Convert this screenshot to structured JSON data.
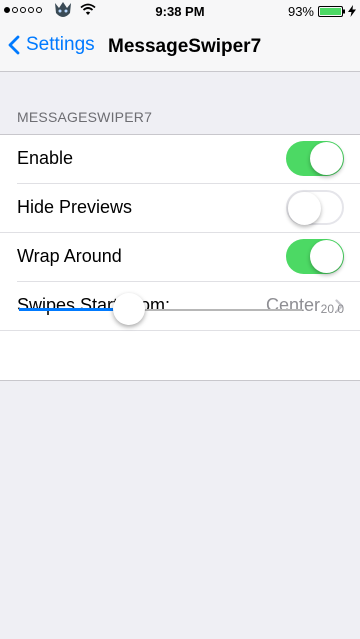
{
  "status_bar": {
    "time": "9:38 PM",
    "battery_percent": "93%",
    "signal_bars_filled": 1,
    "signal_bars_total": 5
  },
  "nav": {
    "back_label": "Settings",
    "title": "MessageSwiper7"
  },
  "section": {
    "header": "MESSAGESWIPER7"
  },
  "rows": {
    "enable": {
      "label": "Enable",
      "on": true
    },
    "hide_previews": {
      "label": "Hide Previews",
      "on": false
    },
    "wrap_around": {
      "label": "Wrap Around",
      "on": true
    },
    "swipes_start": {
      "label": "Swipes Start From:",
      "value": "Center"
    }
  },
  "slider": {
    "value": "20.0"
  },
  "colors": {
    "accent": "#007aff",
    "switch_on": "#4cd964",
    "background": "#efeff4"
  }
}
